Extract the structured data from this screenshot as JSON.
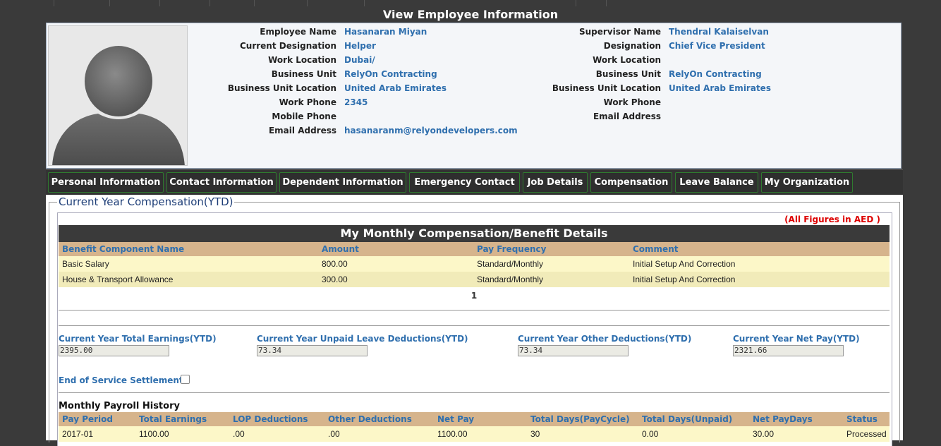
{
  "page_title": "View Employee Information",
  "employee": {
    "left": [
      {
        "label": "Employee Name",
        "value": "Hasanaran Miyan"
      },
      {
        "label": "Current Designation",
        "value": "Helper"
      },
      {
        "label": "Work Location",
        "value": "Dubai/"
      },
      {
        "label": "Business Unit",
        "value": "RelyOn Contracting"
      },
      {
        "label": "Business Unit Location",
        "value": "United Arab Emirates"
      },
      {
        "label": "Work Phone",
        "value": "2345"
      },
      {
        "label": "Mobile Phone",
        "value": ""
      },
      {
        "label": "Email Address",
        "value": "hasanaranm@relyondevelopers.com"
      }
    ],
    "right": [
      {
        "label": "Supervisor Name",
        "value": "Thendral Kalaiselvan"
      },
      {
        "label": "Designation",
        "value": "Chief Vice President"
      },
      {
        "label": "Work Location",
        "value": ""
      },
      {
        "label": "Business Unit",
        "value": "RelyOn Contracting"
      },
      {
        "label": "Business Unit Location",
        "value": "United Arab Emirates"
      },
      {
        "label": "Work Phone",
        "value": ""
      },
      {
        "label": "Email Address",
        "value": ""
      }
    ]
  },
  "tabs": [
    "Personal Information",
    "Contact Information",
    "Dependent Information",
    "Emergency Contact",
    "Job Details",
    "Compensation",
    "Leave Balance",
    "My Organization"
  ],
  "section_legend": "Current Year Compensation(YTD)",
  "figures_note": "(All Figures in AED )",
  "benefits": {
    "title": "My Monthly Compensation/Benefit Details",
    "columns": [
      "Benefit Component Name",
      "Amount",
      "Pay Frequency",
      "Comment"
    ],
    "rows": [
      [
        "Basic Salary",
        "800.00",
        "Standard/Monthly",
        "Initial Setup And Correction"
      ],
      [
        "House & Transport Allowance",
        "300.00",
        "Standard/Monthly",
        "Initial Setup And Correction"
      ]
    ],
    "page": "1"
  },
  "summary": [
    {
      "label": "Current Year Total Earnings(YTD)",
      "value": "2395.00"
    },
    {
      "label": "Current Year Unpaid Leave Deductions(YTD)",
      "value": "73.34"
    },
    {
      "label": "Current Year Other Deductions(YTD)",
      "value": "73.34"
    },
    {
      "label": "Current Year Net Pay(YTD)",
      "value": "2321.66"
    }
  ],
  "end_of_service": {
    "label": "End of Service Settlement:",
    "checked": false
  },
  "payroll": {
    "title": "Monthly Payroll History",
    "columns": [
      "Pay Period",
      "Total Earnings",
      "LOP Deductions",
      "Other Deductions",
      "Net Pay",
      "Total Days(PayCycle)",
      "Total Days(Unpaid)",
      "Net PayDays",
      "Status"
    ],
    "rows": [
      [
        "2017-01",
        "1100.00",
        ".00",
        ".00",
        "1100.00",
        "30",
        "0.00",
        "30.00",
        "Processed"
      ]
    ]
  },
  "colors": {
    "header_bg": "#3a3a3a",
    "link_blue": "#2f6fae",
    "table_header": "#d6b48c",
    "row_yellow": "#fcf7c8",
    "row_yellow_alt": "#f1ebb9",
    "note_red": "#dd0000"
  }
}
